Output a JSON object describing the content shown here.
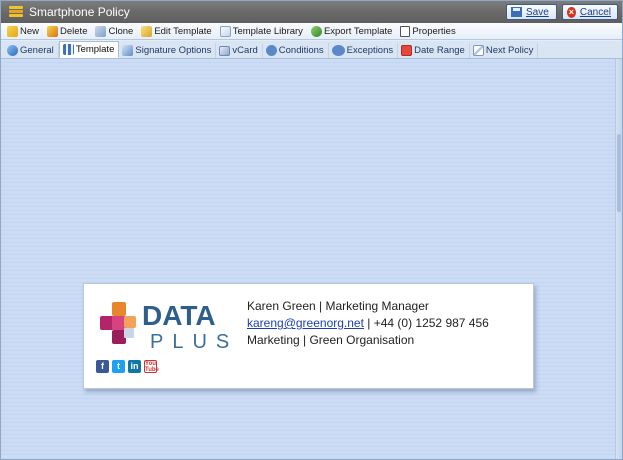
{
  "window": {
    "title": "Smartphone Policy"
  },
  "titlebar": {
    "save_label": "Save",
    "cancel_label": "Cancel"
  },
  "toolbar": {
    "items": [
      {
        "label": "New",
        "icon": "new-icon"
      },
      {
        "label": "Delete",
        "icon": "delete-icon"
      },
      {
        "label": "Clone",
        "icon": "clone-icon"
      },
      {
        "label": "Edit Template",
        "icon": "edit-template-icon"
      },
      {
        "label": "Template Library",
        "icon": "template-library-icon"
      },
      {
        "label": "Export Template",
        "icon": "export-icon"
      },
      {
        "label": "Properties",
        "icon": "properties-icon"
      }
    ]
  },
  "tabs": [
    {
      "label": "General",
      "icon": "general-icon",
      "active": false
    },
    {
      "label": "Template",
      "icon": "template-icon",
      "active": true
    },
    {
      "label": "Signature Options",
      "icon": "signature-options-icon",
      "active": false
    },
    {
      "label": "vCard",
      "icon": "vcard-icon",
      "active": false
    },
    {
      "label": "Conditions",
      "icon": "conditions-icon",
      "active": false
    },
    {
      "label": "Exceptions",
      "icon": "exceptions-icon",
      "active": false
    },
    {
      "label": "Date Range",
      "icon": "date-range-icon",
      "active": false
    },
    {
      "label": "Next Policy",
      "icon": "next-policy-icon",
      "active": false
    }
  ],
  "signature": {
    "logo": {
      "line1": "DATA",
      "line2": "PLUS"
    },
    "name_line": "Karen Green | Marketing Manager",
    "email": "kareng@greenorg.net",
    "phone": " | +44 (0) 1252 987 456",
    "org_line": "Marketing | Green Organisation",
    "socials": [
      "facebook-icon",
      "twitter-icon",
      "linkedin-icon",
      "youtube-icon"
    ]
  },
  "colors": {
    "titlebar": "#6f6f6f",
    "canvas": "#ccdcf5",
    "logo_primary": "#2e5f8a",
    "logo_accent_orange": "#e8862b",
    "logo_accent_magenta": "#b3246b",
    "link": "#1c3fb4"
  }
}
